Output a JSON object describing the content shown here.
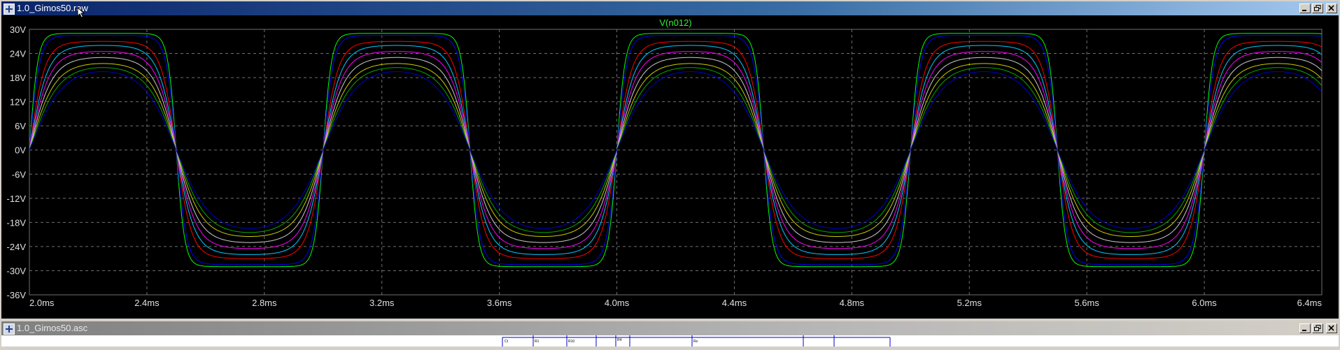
{
  "window_plot": {
    "title": "1.0_Gimos50.raw",
    "trace_label": "V(n012)"
  },
  "window_schematic": {
    "title": "1.0_Gimos50.asc",
    "schematic_labels": [
      "Ct",
      "R1",
      "R10",
      "R4",
      "Rs"
    ]
  },
  "window_buttons": {
    "minimize": "minimize",
    "restore": "restore",
    "close": "close"
  },
  "colors": {
    "background": "#000000",
    "grid": "#707070",
    "axis_text": "#e0e0e0",
    "trace_label": "#33ee33",
    "chrome": "#d4d0c8"
  },
  "chart_data": {
    "type": "line",
    "title": "V(n012)",
    "xlabel": "",
    "ylabel": "",
    "x_unit": "ms",
    "xlim": [
      2.0,
      6.4
    ],
    "ylim": [
      -36,
      30
    ],
    "x_ticks": [
      "2.0ms",
      "2.4ms",
      "2.8ms",
      "3.2ms",
      "3.6ms",
      "4.0ms",
      "4.4ms",
      "4.8ms",
      "5.2ms",
      "5.6ms",
      "6.0ms",
      "6.4ms"
    ],
    "y_ticks": [
      "30V",
      "24V",
      "18V",
      "12V",
      "6V",
      "0V",
      "-6V",
      "-12V",
      "-18V",
      "-24V",
      "-30V",
      "-36V"
    ],
    "grid": true,
    "signal": {
      "shape": "sine",
      "frequency_hz": 1000,
      "zero_crossing_ms": 2.0
    },
    "series": [
      {
        "color": "#00ff00",
        "amplitude_v": 29,
        "clipping": 0.9
      },
      {
        "color": "#0000ff",
        "amplitude_v": 28.5,
        "clipping": 0.7
      },
      {
        "color": "#ff0000",
        "amplitude_v": 27,
        "clipping": 0.4
      },
      {
        "color": "#00ccff",
        "amplitude_v": 26,
        "clipping": 0.3
      },
      {
        "color": "#ff00ff",
        "amplitude_v": 24.5,
        "clipping": 0.25
      },
      {
        "color": "#cccccc",
        "amplitude_v": 23,
        "clipping": 0.2
      },
      {
        "color": "#cccc00",
        "amplitude_v": 21.5,
        "clipping": 0.15
      },
      {
        "color": "#00aa00",
        "amplitude_v": 20.5,
        "clipping": 0.1
      },
      {
        "color": "#0000cc",
        "amplitude_v": 19.5,
        "clipping": 0.05
      }
    ]
  }
}
